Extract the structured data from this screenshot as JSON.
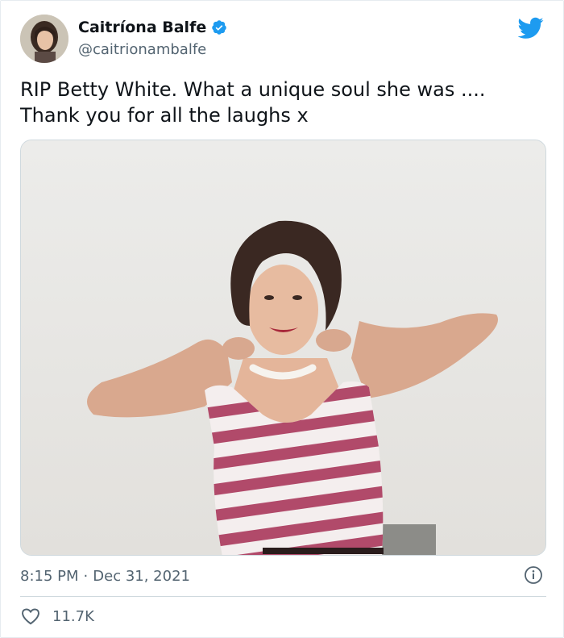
{
  "author": {
    "display_name": "Caitríona Balfe",
    "handle": "@caitrionambalfe",
    "verified": true,
    "avatar_icon": "profile-photo"
  },
  "tweet": {
    "text": "RIP Betty White. What a unique soul she was ....\nThank you for all the laughs x",
    "media_description_icon": "photo-woman-striped-dress",
    "time": "8:15 PM",
    "separator": "·",
    "date": "Dec 31, 2021"
  },
  "stats": {
    "likes": "11.7K"
  },
  "colors": {
    "twitter_blue": "#1d9bf0",
    "text_primary": "#0f1419",
    "text_secondary": "#536471",
    "stripe": "#b14a6a"
  }
}
